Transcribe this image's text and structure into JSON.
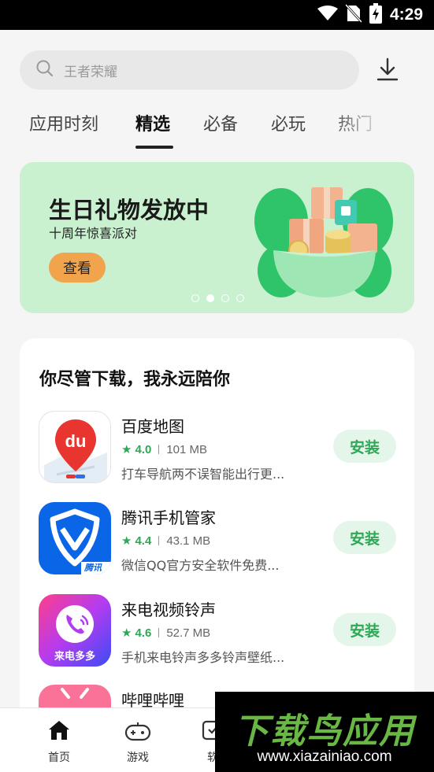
{
  "status_bar": {
    "time": "4:29"
  },
  "search": {
    "placeholder": "王者荣耀"
  },
  "tabs": [
    {
      "label": "应用时刻",
      "active": false
    },
    {
      "label": "精选",
      "active": true
    },
    {
      "label": "必备",
      "active": false
    },
    {
      "label": "必玩",
      "active": false
    },
    {
      "label": "热门",
      "active": false
    }
  ],
  "banner": {
    "title": "生日礼物发放中",
    "subtitle": "十周年惊喜派对",
    "button_label": "查看",
    "page_count": 4,
    "active_page": 2,
    "background_color": "#c9f1cf",
    "button_color": "#f2a44c"
  },
  "section": {
    "title": "你尽管下载，我永远陪你",
    "apps": [
      {
        "name": "百度地图",
        "rating": "4.0",
        "size": "101 MB",
        "description": "打车导航两不误智能出行更...",
        "install_label": "安装",
        "icon": "baidu-map-icon"
      },
      {
        "name": "腾讯手机管家",
        "rating": "4.4",
        "size": "43.1 MB",
        "description": "微信QQ官方安全软件免费...",
        "install_label": "安装",
        "icon": "tencent-manager-icon",
        "icon_badge": "腾讯"
      },
      {
        "name": "来电视频铃声",
        "rating": "4.6",
        "size": "52.7 MB",
        "description": "手机来电铃声多多铃声壁纸...",
        "install_label": "安装",
        "icon": "ringtone-icon",
        "icon_badge": "来电多多"
      },
      {
        "name": "哔哩哔哩",
        "icon": "bilibili-icon"
      }
    ]
  },
  "bottom_nav": [
    {
      "label": "首页",
      "icon": "home-icon",
      "active": true
    },
    {
      "label": "游戏",
      "icon": "gamepad-icon",
      "active": false
    },
    {
      "label": "软",
      "icon": "software-icon",
      "active": false
    }
  ],
  "watermark": {
    "title": "下载鸟应用",
    "url": "www.xiazainiao.com"
  },
  "colors": {
    "accent_green": "#2ea857",
    "install_bg": "#e4f6ea"
  }
}
